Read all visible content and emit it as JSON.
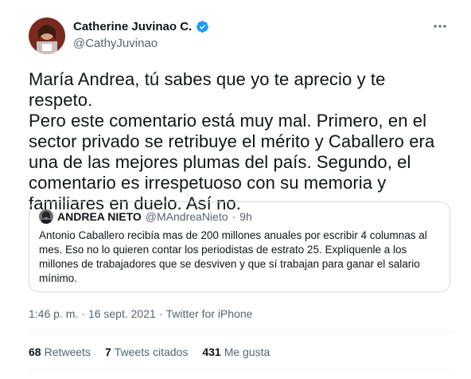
{
  "tweet": {
    "author": {
      "display_name": "Catherine Juvinao C.",
      "handle": "@CathyJuvinao",
      "verified_icon": "verified-badge-icon",
      "accent": "#1d9bf0"
    },
    "more_icon": "more-options-icon",
    "text": "María Andrea, tú sabes que yo te aprecio y te respeto.\nPero este comentario está muy mal. Primero, en el\nsector privado se retribuye el mérito y Caballero era\nuna de las mejores plumas del país. Segundo, el\ncomentario es irrespetuoso con su memoria y\nfamiliares en duelo. Así no.",
    "quoted": {
      "display_name": "ANDREA NIETO",
      "handle": "@MAndreaNieto",
      "separator": "·",
      "time": "9h",
      "text": "Antonio Caballero recibía mas de 200 millones anuales por escribir 4 columnas al mes. Eso no lo quieren contar los periodistas de estrato 25. Explíquenle a los millones de trabajadores que se desviven y que sí trabajan para ganar el salario mínimo."
    },
    "meta": {
      "time": "1:46 p. m.",
      "separator1": "·",
      "date": "16 sept. 2021",
      "separator2": "·",
      "source": "Twitter for iPhone"
    },
    "stats": {
      "retweets_count": "68",
      "retweets_label": "Retweets",
      "quotes_count": "7",
      "quotes_label": "Tweets citados",
      "likes_count": "431",
      "likes_label": "Me gusta"
    }
  }
}
